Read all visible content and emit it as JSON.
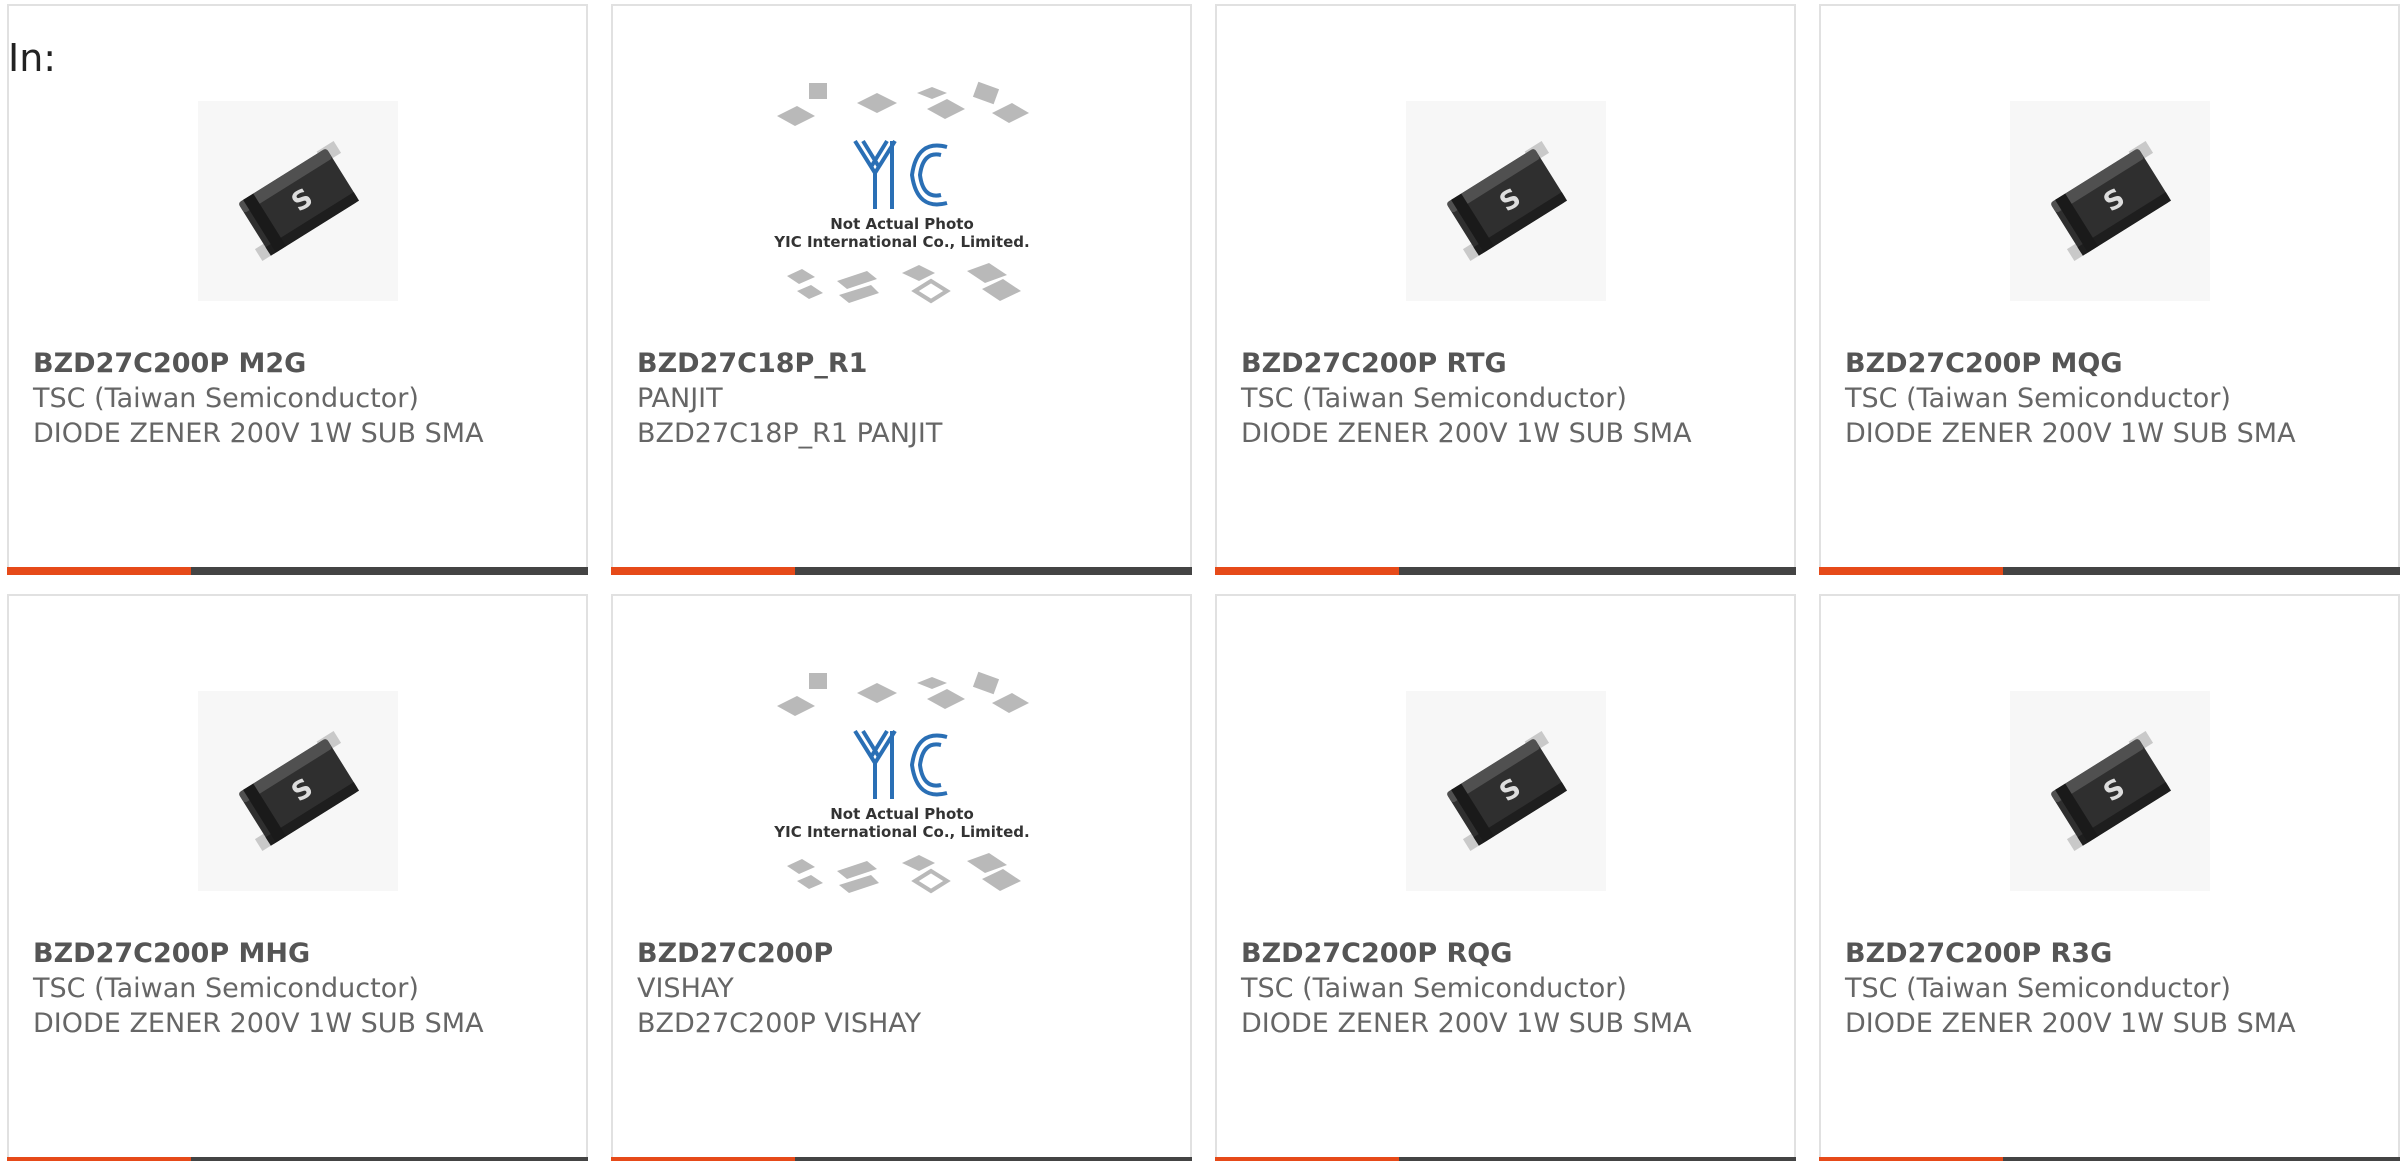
{
  "heading": "In:",
  "colors": {
    "accent": "#e64a19",
    "bar": "#444444",
    "border": "#e1e1e1",
    "text": "#666666"
  },
  "products": [
    {
      "part_number": "BZD27C200P M2G",
      "manufacturer": "TSC (Taiwan Semiconductor)",
      "description": "DIODE ZENER 200V 1W SUB SMA",
      "image": "tsc-sma-diode-icon"
    },
    {
      "part_number": "BZD27C18P_R1",
      "manufacturer": "PANJIT",
      "description": "BZD27C18P_R1 PANJIT",
      "image": "yic-placeholder-icon",
      "placeholder_lines": [
        "Not Actual Photo",
        "YIC International Co., Limited."
      ]
    },
    {
      "part_number": "BZD27C200P RTG",
      "manufacturer": "TSC (Taiwan Semiconductor)",
      "description": "DIODE ZENER 200V 1W SUB SMA",
      "image": "tsc-sma-diode-icon"
    },
    {
      "part_number": "BZD27C200P MQG",
      "manufacturer": "TSC (Taiwan Semiconductor)",
      "description": "DIODE ZENER 200V 1W SUB SMA",
      "image": "tsc-sma-diode-icon"
    },
    {
      "part_number": "BZD27C200P MHG",
      "manufacturer": "TSC (Taiwan Semiconductor)",
      "description": "DIODE ZENER 200V 1W SUB SMA",
      "image": "tsc-sma-diode-icon"
    },
    {
      "part_number": "BZD27C200P",
      "manufacturer": "VISHAY",
      "description": "BZD27C200P VISHAY",
      "image": "yic-placeholder-icon",
      "placeholder_lines": [
        "Not Actual Photo",
        "YIC International Co., Limited."
      ]
    },
    {
      "part_number": "BZD27C200P RQG",
      "manufacturer": "TSC (Taiwan Semiconductor)",
      "description": "DIODE ZENER 200V 1W SUB SMA",
      "image": "tsc-sma-diode-icon"
    },
    {
      "part_number": "BZD27C200P R3G",
      "manufacturer": "TSC (Taiwan Semiconductor)",
      "description": "DIODE ZENER 200V 1W SUB SMA",
      "image": "tsc-sma-diode-icon"
    }
  ]
}
